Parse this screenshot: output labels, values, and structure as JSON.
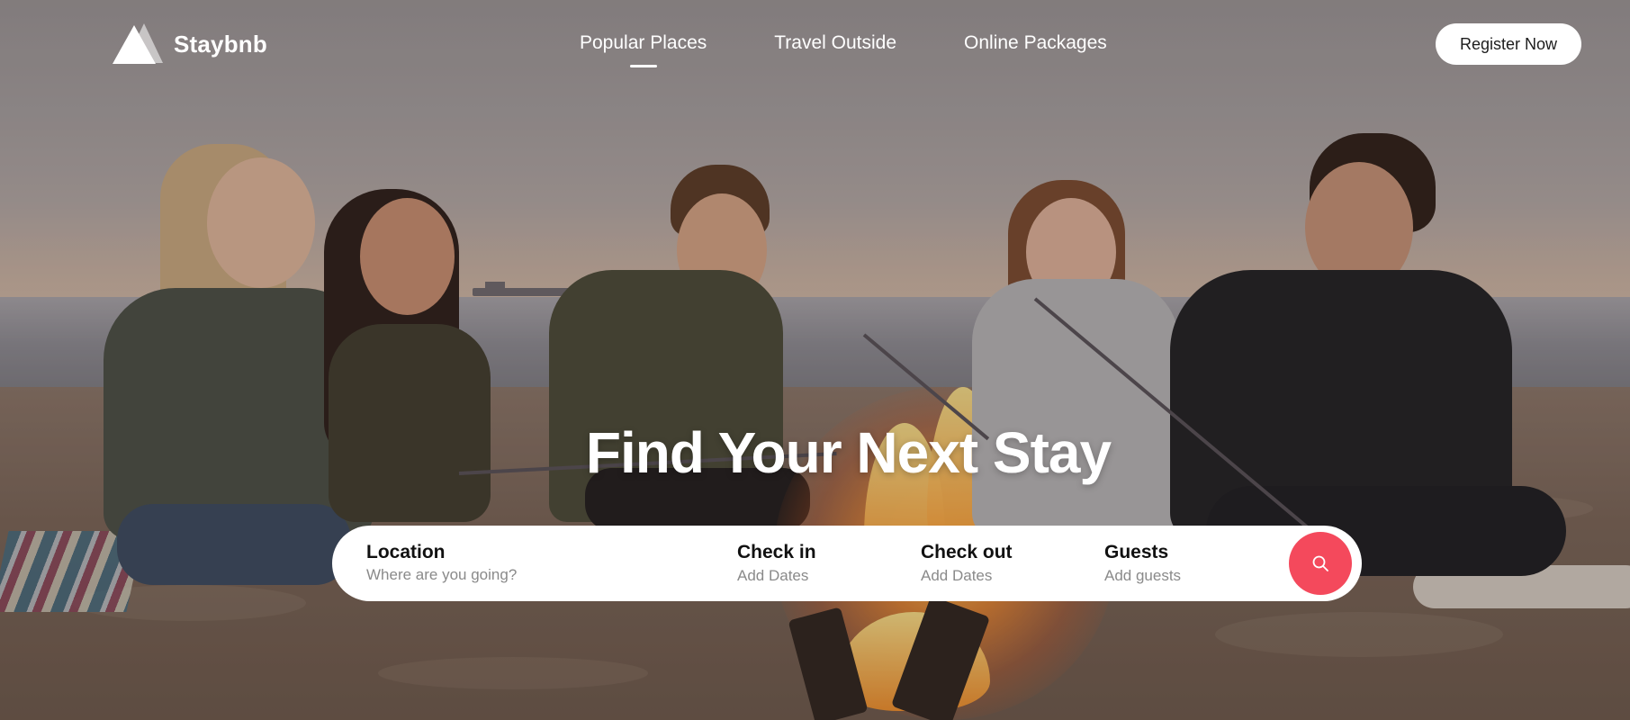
{
  "brand": {
    "name": "Staybnb",
    "logo_icon": "triangle-mountain-logo"
  },
  "nav": {
    "items": [
      {
        "label": "Popular Places",
        "active": true
      },
      {
        "label": "Travel Outside",
        "active": false
      },
      {
        "label": "Online Packages",
        "active": false
      }
    ],
    "register_label": "Register Now"
  },
  "hero": {
    "headline": "Find Your Next Stay",
    "background": "photo: friends around a campfire on the beach at sunset"
  },
  "search": {
    "location_label": "Location",
    "location_placeholder": "Where are you going?",
    "checkin_label": "Check in",
    "checkin_hint": "Add Dates",
    "checkout_label": "Check out",
    "checkout_hint": "Add Dates",
    "guests_label": "Guests",
    "guests_hint": "Add guests",
    "search_icon": "search-icon"
  },
  "colors": {
    "accent": "#f4495c",
    "text_on_hero": "#ffffff",
    "search_bar_bg": "#ffffff",
    "hint_text": "#8a8a8a"
  }
}
